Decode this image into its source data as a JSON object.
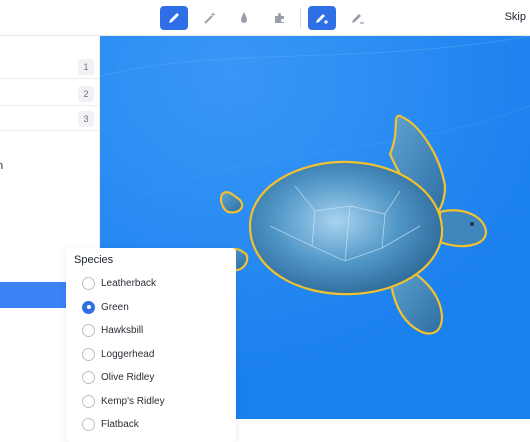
{
  "toolbar": {
    "skip_label": "Skip"
  },
  "left_panel": {
    "rows": [
      "1",
      "2",
      "3"
    ],
    "partial_text": "n"
  },
  "species": {
    "title": "Species",
    "options": [
      "Leatherback",
      "Green",
      "Hawksbill",
      "Loggerhead",
      "Olive Ridley",
      "Kemp's Ridley",
      "Flatback"
    ],
    "selected": "Green"
  },
  "colors": {
    "accent": "#2f6fe6",
    "canvas_bg": "#1d86f1",
    "annotation_outline": "#f2c12e"
  },
  "icons": [
    "pencil-icon",
    "magic-wand-icon",
    "drop-icon",
    "puzzle-icon",
    "pencil-plus-icon",
    "pencil-minus-icon"
  ]
}
